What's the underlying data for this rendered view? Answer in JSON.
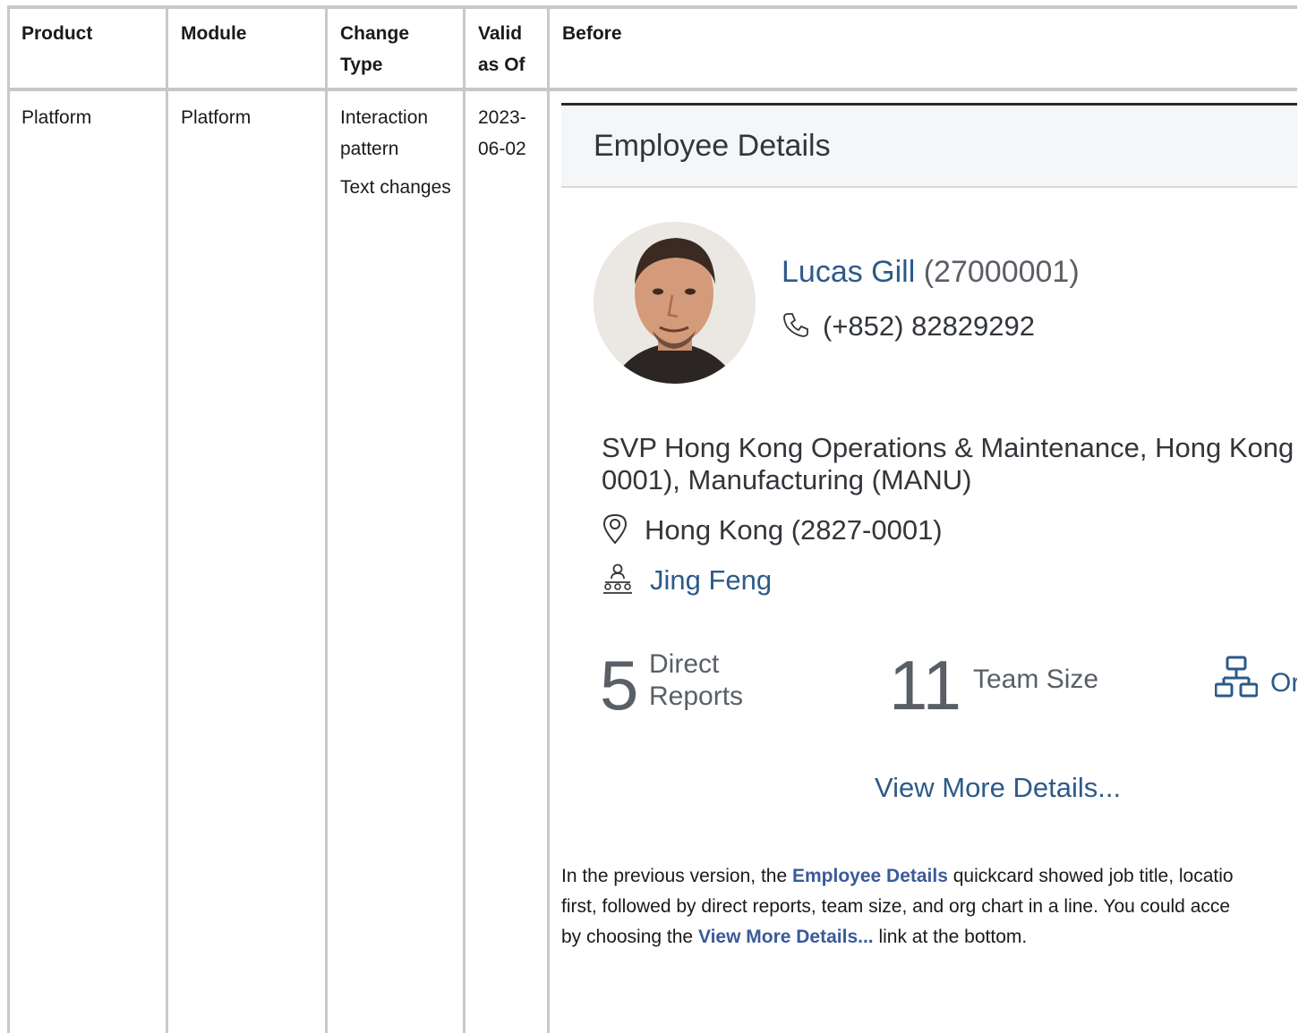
{
  "headers": {
    "product": "Product",
    "module": "Module",
    "change_type_1": "Change",
    "change_type_2": "Type",
    "valid_1": "Valid",
    "valid_2": "as Of",
    "before": "Before"
  },
  "row": {
    "product": "Platform",
    "module": "Platform",
    "change_types": [
      "Interaction pattern",
      "Text changes"
    ],
    "valid_1": "2023-",
    "valid_2": "06-02"
  },
  "card": {
    "title": "Employee Details",
    "name": "Lucas Gill",
    "employee_id": "(27000001)",
    "phone": "(+852) 82829292",
    "job_line1": "SVP Hong Kong Operations & Maintenance, Hong Kong",
    "job_line2": "0001), Manufacturing (MANU)",
    "location": "Hong Kong (2827-0001)",
    "manager": "Jing Feng",
    "direct_reports_count": "5",
    "direct_reports_label1": "Direct",
    "direct_reports_label2": "Reports",
    "team_size_count": "11",
    "team_size_label": "Team Size",
    "org_chart_label": "Or",
    "view_more": "View More Details..."
  },
  "description": {
    "line1_a": "In the previous version, the ",
    "line1_link": "Employee Details",
    "line1_b": " quickcard showed job title, locatio",
    "line2": "first, followed by direct reports, team size, and org chart in a line. You could acce",
    "line3_a": "by choosing the ",
    "line3_link": "View More Details...",
    "line3_b": " link at the bottom."
  },
  "colors": {
    "link": "#2c5a8a",
    "desc_link": "#3b5a9a",
    "grid": "#c8c8c8"
  }
}
